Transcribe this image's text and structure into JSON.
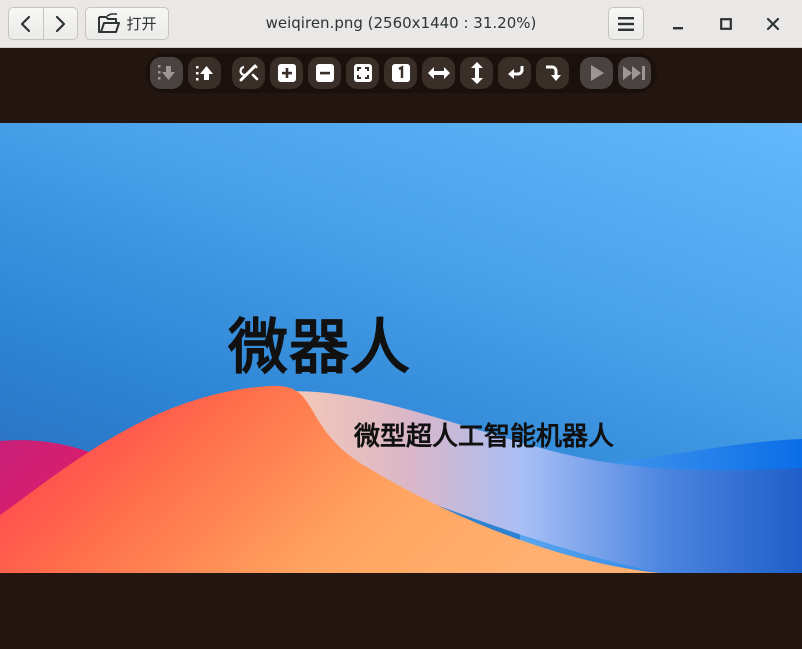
{
  "window": {
    "title": "weiqiren.png (2560x1440 : 31.20%)",
    "open_label": "打开"
  },
  "header_buttons": {
    "back_icon": "chevron-left-icon",
    "forward_icon": "chevron-right-icon",
    "open_icon": "folder-open-icon",
    "menu_icon": "hamburger-menu-icon",
    "minimize_icon": "minimize-icon",
    "maximize_icon": "maximize-icon",
    "close_icon": "close-icon"
  },
  "toolbar": {
    "buttons": [
      {
        "icon": "previous-image-icon",
        "enabled": false
      },
      {
        "icon": "next-image-icon",
        "enabled": true
      },
      {
        "icon": "edit-tools-icon",
        "enabled": true
      },
      {
        "icon": "zoom-in-icon",
        "enabled": true
      },
      {
        "icon": "zoom-out-icon",
        "enabled": true
      },
      {
        "icon": "fit-window-icon",
        "enabled": true
      },
      {
        "icon": "original-size-icon",
        "enabled": true
      },
      {
        "icon": "flip-horizontal-icon",
        "enabled": true
      },
      {
        "icon": "flip-vertical-icon",
        "enabled": true
      },
      {
        "icon": "rotate-left-icon",
        "enabled": true
      },
      {
        "icon": "rotate-right-icon",
        "enabled": true
      },
      {
        "icon": "play-slideshow-icon",
        "enabled": false
      },
      {
        "icon": "skip-to-end-icon",
        "enabled": false
      }
    ]
  },
  "image": {
    "heading": "微器人",
    "subheading": "微型超人工智能机器人"
  },
  "colors": {
    "header_bg": "#e9e8e6",
    "canvas_bg": "#231610",
    "toolbar_bg": "#1a110c",
    "toolbar_button": "#3a2e29"
  }
}
